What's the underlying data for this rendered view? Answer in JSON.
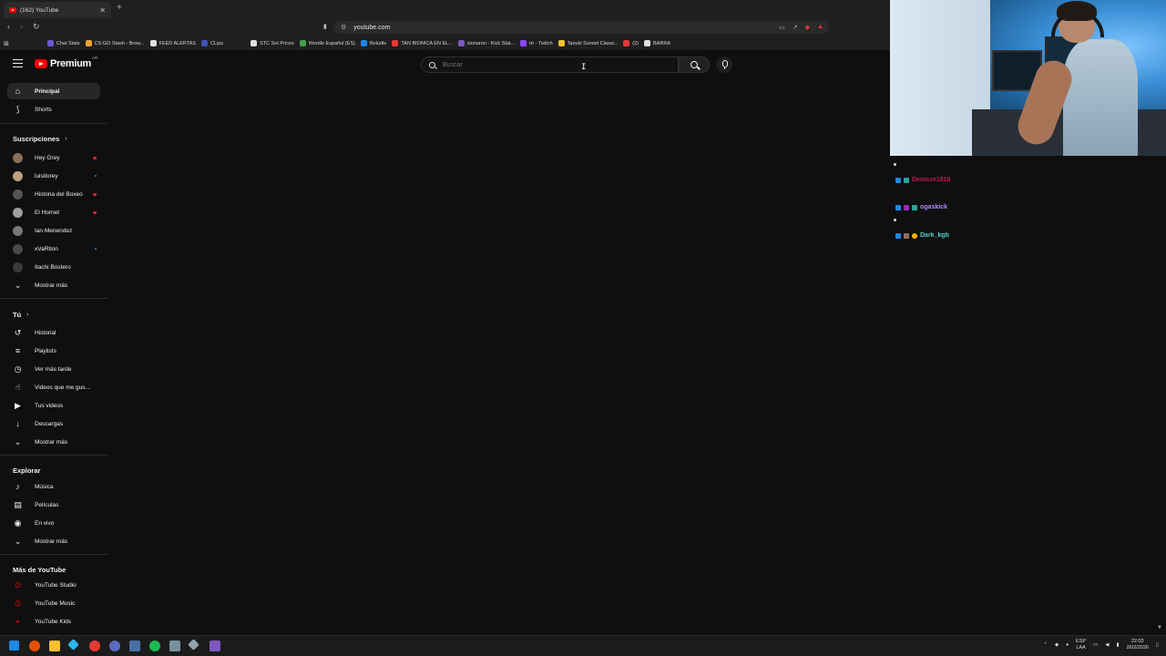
{
  "browser": {
    "tab_title": "(162) YouTube",
    "url": "youtube.com",
    "bookmarks": [
      {
        "label": "Chat Stats",
        "color": "#6a5acd"
      },
      {
        "label": "CS:GO Stash - Brow...",
        "color": "#f0a030"
      },
      {
        "label": "FEED ALERTAS",
        "color": "#e0e0e0"
      },
      {
        "label": "CLips",
        "color": "#3f51b5"
      },
      {
        "label": "STC Set Prices",
        "color": "#e0e0e0"
      },
      {
        "label": "Wordle Español (ES)",
        "color": "#43a047"
      },
      {
        "label": "Boludle",
        "color": "#1e88e5"
      },
      {
        "label": "TAN BIONICA EN EL...",
        "color": "#e53935"
      },
      {
        "label": "sionaron - Kick Stat...",
        "color": "#7e57c2"
      },
      {
        "label": "trr - Twitch",
        "color": "#9146ff"
      },
      {
        "label": "Tanuki Sunset Classi...",
        "color": "#fbc02d"
      },
      {
        "label": "(2)",
        "color": "#e53935"
      },
      {
        "label": "BARRA",
        "color": "#e0e0e0"
      }
    ]
  },
  "header": {
    "logo_text": "Premium",
    "logo_country": "AR",
    "search_placeholder": "Buscar"
  },
  "sidebar": {
    "main": [
      {
        "label": "Principal",
        "icon": "home-icon",
        "active": true
      },
      {
        "label": "Shorts",
        "icon": "shorts-icon"
      }
    ],
    "subscriptions_title": "Suscripciones",
    "subscriptions": [
      {
        "label": "Hey Grey",
        "color": "#8a6f5a",
        "live": "#c62828"
      },
      {
        "label": "luisitorey",
        "color": "#c0a080",
        "live": "#1e88e5"
      },
      {
        "label": "Historia del Boxeo",
        "color": "#555555",
        "live": "#c62828"
      },
      {
        "label": "El Hornet",
        "color": "#9e9e9e",
        "live": "#c62828"
      },
      {
        "label": "Ian Menendez",
        "color": "#777777"
      },
      {
        "label": "xVaRtion",
        "color": "#4a4a4a",
        "live": "#1e88e5"
      },
      {
        "label": "Itachi Bostero",
        "color": "#3a3a3a"
      }
    ],
    "show_more": "Mostrar más",
    "you_title": "Tú",
    "you": [
      {
        "label": "Historial",
        "icon": "history-icon"
      },
      {
        "label": "Playlists",
        "icon": "playlists-icon"
      },
      {
        "label": "Ver más tarde",
        "icon": "watch-later-icon"
      },
      {
        "label": "Videos que me gus...",
        "icon": "thumb-up-icon"
      },
      {
        "label": "Tus videos",
        "icon": "your-videos-icon"
      },
      {
        "label": "Descargas",
        "icon": "download-icon"
      }
    ],
    "explore_title": "Explorar",
    "explore": [
      {
        "label": "Música",
        "icon": "music-icon"
      },
      {
        "label": "Películas",
        "icon": "movies-icon"
      },
      {
        "label": "En vivo",
        "icon": "live-icon"
      }
    ],
    "more_title": "Más de YouTube",
    "more": [
      {
        "label": "YouTube Studio",
        "color": "#ff0000"
      },
      {
        "label": "YouTube Music",
        "color": "#ff0000"
      },
      {
        "label": "YouTube Kids",
        "color": "#ff0000"
      }
    ]
  },
  "chat": [
    {
      "user": "Denisse1818",
      "color": "#c2185b"
    },
    {
      "user": "ogaskick",
      "color": "#b388ff"
    },
    {
      "user": "Dark_kgb",
      "color": "#4dd0c8"
    }
  ],
  "taskbar": {
    "lang": "ESP",
    "region": "LAA",
    "time": "22:03",
    "date": "26/2/2026"
  }
}
